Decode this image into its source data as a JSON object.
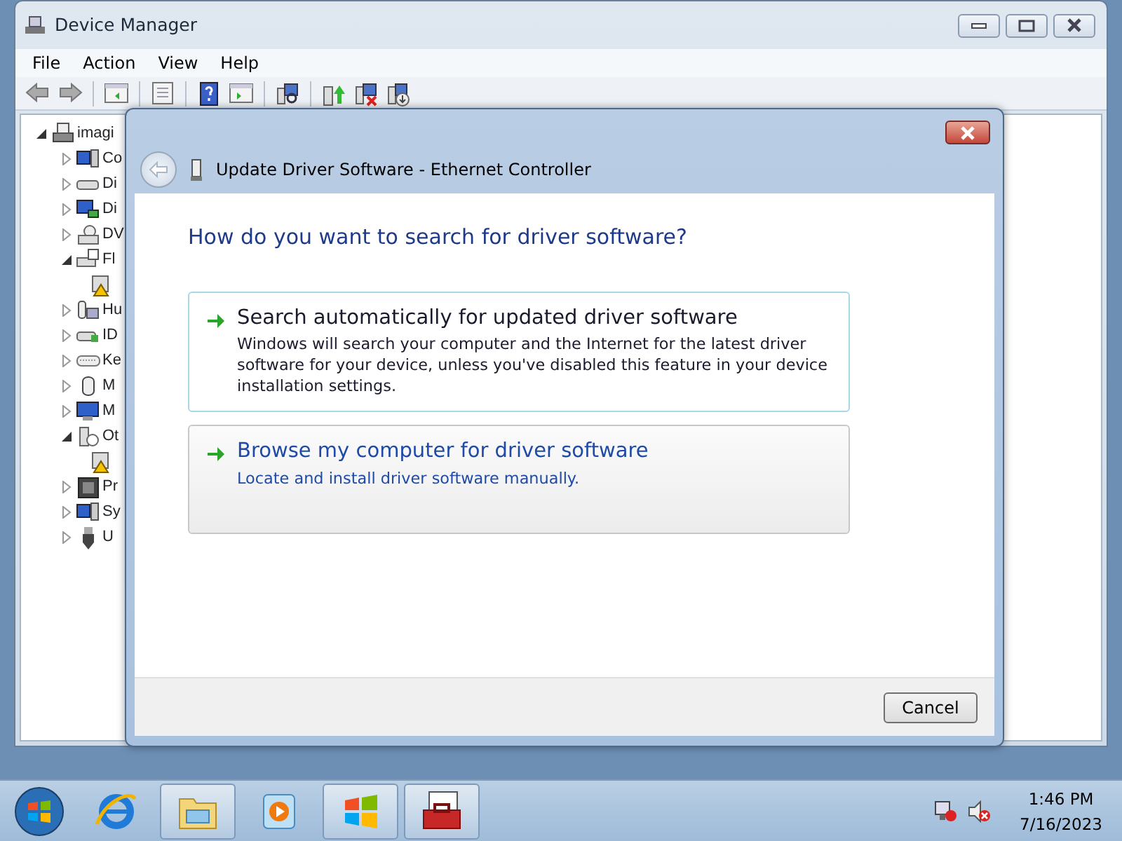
{
  "window": {
    "title": "Device Manager"
  },
  "menu": [
    "File",
    "Action",
    "View",
    "Help"
  ],
  "tree": {
    "label": "imagi",
    "expanded": true,
    "children": [
      {
        "label": "Co",
        "expanded": false
      },
      {
        "label": "Di",
        "expanded": false
      },
      {
        "label": "Di",
        "expanded": false
      },
      {
        "label": "DV",
        "expanded": false
      },
      {
        "label": "Fl",
        "expanded": true,
        "children": [
          {
            "warning": true
          }
        ]
      },
      {
        "label": "Hu",
        "expanded": false
      },
      {
        "label": "ID",
        "expanded": false
      },
      {
        "label": "Ke",
        "expanded": false
      },
      {
        "label": "M",
        "expanded": false
      },
      {
        "label": "M",
        "expanded": false
      },
      {
        "label": "Ot",
        "expanded": true,
        "children": [
          {
            "warning": true
          }
        ]
      },
      {
        "label": "Pr",
        "expanded": false
      },
      {
        "label": "Sy",
        "expanded": false
      },
      {
        "label": "U",
        "expanded": false
      }
    ]
  },
  "dialog": {
    "title": "Update Driver Software - Ethernet Controller",
    "heading": "How do you want to search for driver software?",
    "options": [
      {
        "title": "Search automatically for updated driver software",
        "description": "Windows will search your computer and the Internet for the latest driver software for your device, unless you've disabled this feature in your device installation settings.",
        "focused": true,
        "hovered": false
      },
      {
        "title": "Browse my computer for driver software",
        "description": "Locate and install driver software manually.",
        "focused": false,
        "hovered": true
      }
    ],
    "buttons": [
      "Cancel"
    ]
  },
  "taskbar": {
    "items": [
      {
        "kind": "browser",
        "running": false
      },
      {
        "kind": "explorer",
        "running": true
      },
      {
        "kind": "media",
        "running": false
      },
      {
        "kind": "windows",
        "running": true
      },
      {
        "kind": "toolbox",
        "running": true
      }
    ],
    "time": "1:46 PM",
    "date": "7/16/2023"
  }
}
